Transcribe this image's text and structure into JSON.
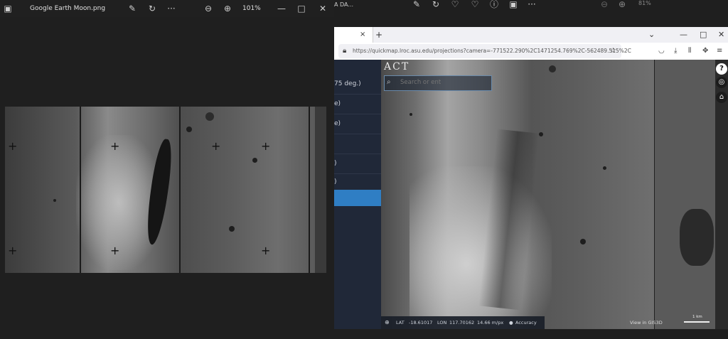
{
  "viewer": {
    "title": "Google Earth Moon.png",
    "zoom": "101%",
    "icons": [
      "gallery-icon",
      "edit-icon",
      "rotate-icon",
      "more-icon",
      "zoom-out-icon",
      "zoom-in-icon",
      "minimize-icon",
      "maximize-icon",
      "close-icon"
    ]
  },
  "background_window": {
    "title": "A DA...",
    "zoom": "81%"
  },
  "browser": {
    "tab_close": "×",
    "new_tab": "+",
    "url": "https://quickmap.lroc.asu.edu/projections?camera=-771522.290%2C1471254.769%2C-562489.515%2C",
    "window_controls": [
      "⌄",
      "—",
      "□",
      "✕"
    ]
  },
  "map": {
    "brand": "ACT",
    "search_placeholder": "Search or ent",
    "side_rows": [
      "75 deg.)",
      "e)",
      "e)",
      "",
      ")",
      ")"
    ],
    "status": {
      "lat_label": "LAT",
      "lat_value": "-18.61017",
      "lon_label": "LON",
      "lon_value": "117.70162",
      "resolution": "14.66 m/px",
      "accuracy": "Accuracy"
    },
    "view_in": "View in GIS3D",
    "scale": "1 km"
  },
  "colors": {
    "panel_bg": "#202838",
    "selected_row": "#2f7ec4",
    "viewer_bg": "#1f1f1f"
  }
}
